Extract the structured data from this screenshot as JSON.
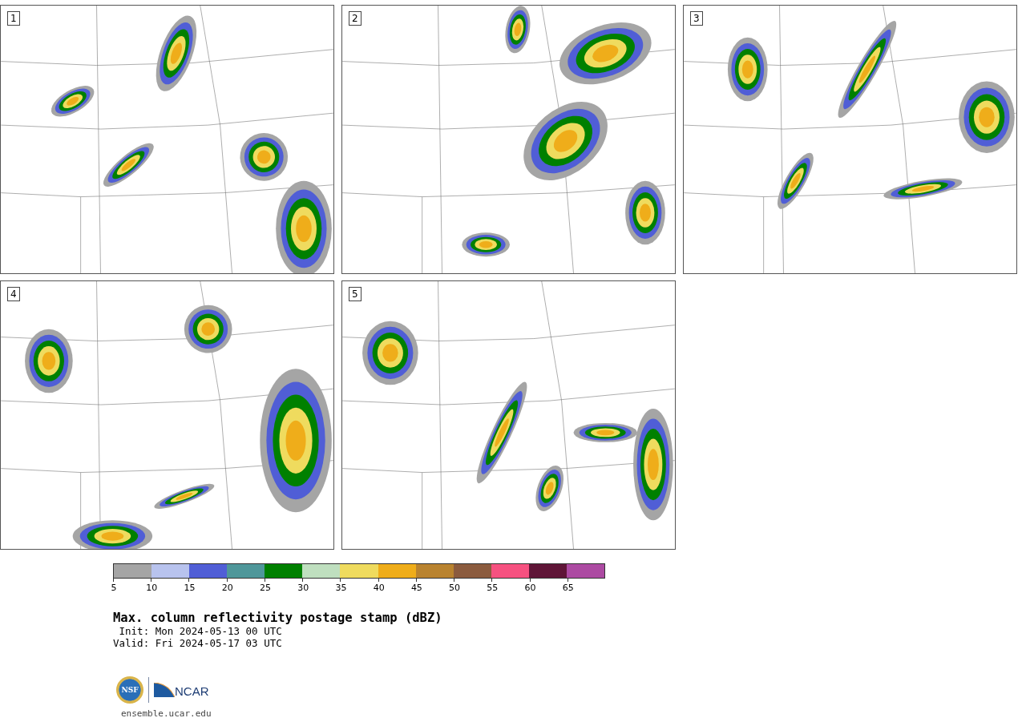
{
  "panels": [
    {
      "label": "1"
    },
    {
      "label": "2"
    },
    {
      "label": "3"
    },
    {
      "label": "4"
    },
    {
      "label": "5"
    }
  ],
  "colorbar": {
    "segments": [
      {
        "color": "#a5a5a5",
        "tick": "5"
      },
      {
        "color": "#b8c3ee",
        "tick": "10"
      },
      {
        "color": "#505ed6",
        "tick": "15"
      },
      {
        "color": "#4f979a",
        "tick": "20"
      },
      {
        "color": "#008000",
        "tick": "25"
      },
      {
        "color": "#bfdfbf",
        "tick": "30"
      },
      {
        "color": "#efdb5e",
        "tick": "35"
      },
      {
        "color": "#efad1a",
        "tick": "40"
      },
      {
        "color": "#b9832f",
        "tick": "45"
      },
      {
        "color": "#8b5b3e",
        "tick": "50"
      },
      {
        "color": "#f65180",
        "tick": "55"
      },
      {
        "color": "#5f1537",
        "tick": "60"
      },
      {
        "color": "#ac4aa2",
        "tick": "65"
      }
    ]
  },
  "title": "Max. column reflectivity postage stamp (dBZ)",
  "init": " Init: Mon 2024-05-13 00 UTC",
  "valid": "Valid: Fri 2024-05-17 03 UTC",
  "logos": {
    "nsf": "NSF",
    "ncar": "NCAR"
  },
  "footer_link": "ensemble.ucar.edu"
}
